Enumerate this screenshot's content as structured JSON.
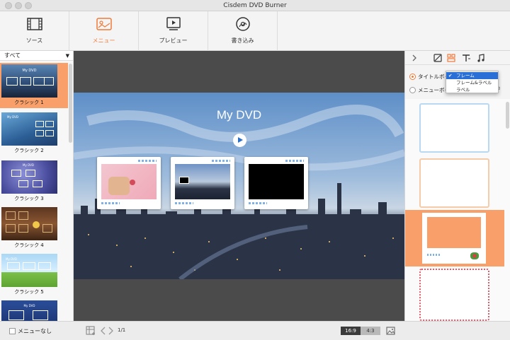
{
  "window": {
    "title": "Cisdem DVD Burner"
  },
  "toolbar": {
    "tabs": [
      {
        "label": "ソース",
        "icon": "film-icon"
      },
      {
        "label": "メニュー",
        "icon": "menu-template-icon",
        "active": true
      },
      {
        "label": "プレビュー",
        "icon": "play-preview-icon"
      },
      {
        "label": "書き込み",
        "icon": "burn-disc-icon"
      }
    ]
  },
  "sidebar": {
    "filter": "すべて",
    "templates": [
      {
        "name": "クラシック 1",
        "selected": true,
        "thumb_title": "My DVD"
      },
      {
        "name": "クラシック 2",
        "thumb_title": "My DVD"
      },
      {
        "name": "クラシック 3",
        "thumb_title": "My DVD"
      },
      {
        "name": "クラシック 4"
      },
      {
        "name": "クラシック 5",
        "thumb_title": "My DVD"
      },
      {
        "name": "",
        "thumb_title": "My DVD"
      }
    ]
  },
  "canvas": {
    "menu_title": "My DVD"
  },
  "right_panel": {
    "tabs": [
      "background-icon",
      "layout-icon",
      "text-icon",
      "music-icon"
    ],
    "options": [
      {
        "label": "タイトルボタン",
        "selected": true
      },
      {
        "label": "メニューボタン",
        "selected": false
      }
    ],
    "dropdown": {
      "items": [
        "フレーム",
        "フレーム&ラベル",
        "ラベル"
      ],
      "selected_index": 0
    }
  },
  "bottom": {
    "no_menu_label": "メニューなし",
    "page": "1/1",
    "ratio_16_9": "16:9",
    "ratio_4_3": "4:3"
  },
  "colors": {
    "accent": "#f07a3a",
    "selection": "#f9a06a"
  }
}
